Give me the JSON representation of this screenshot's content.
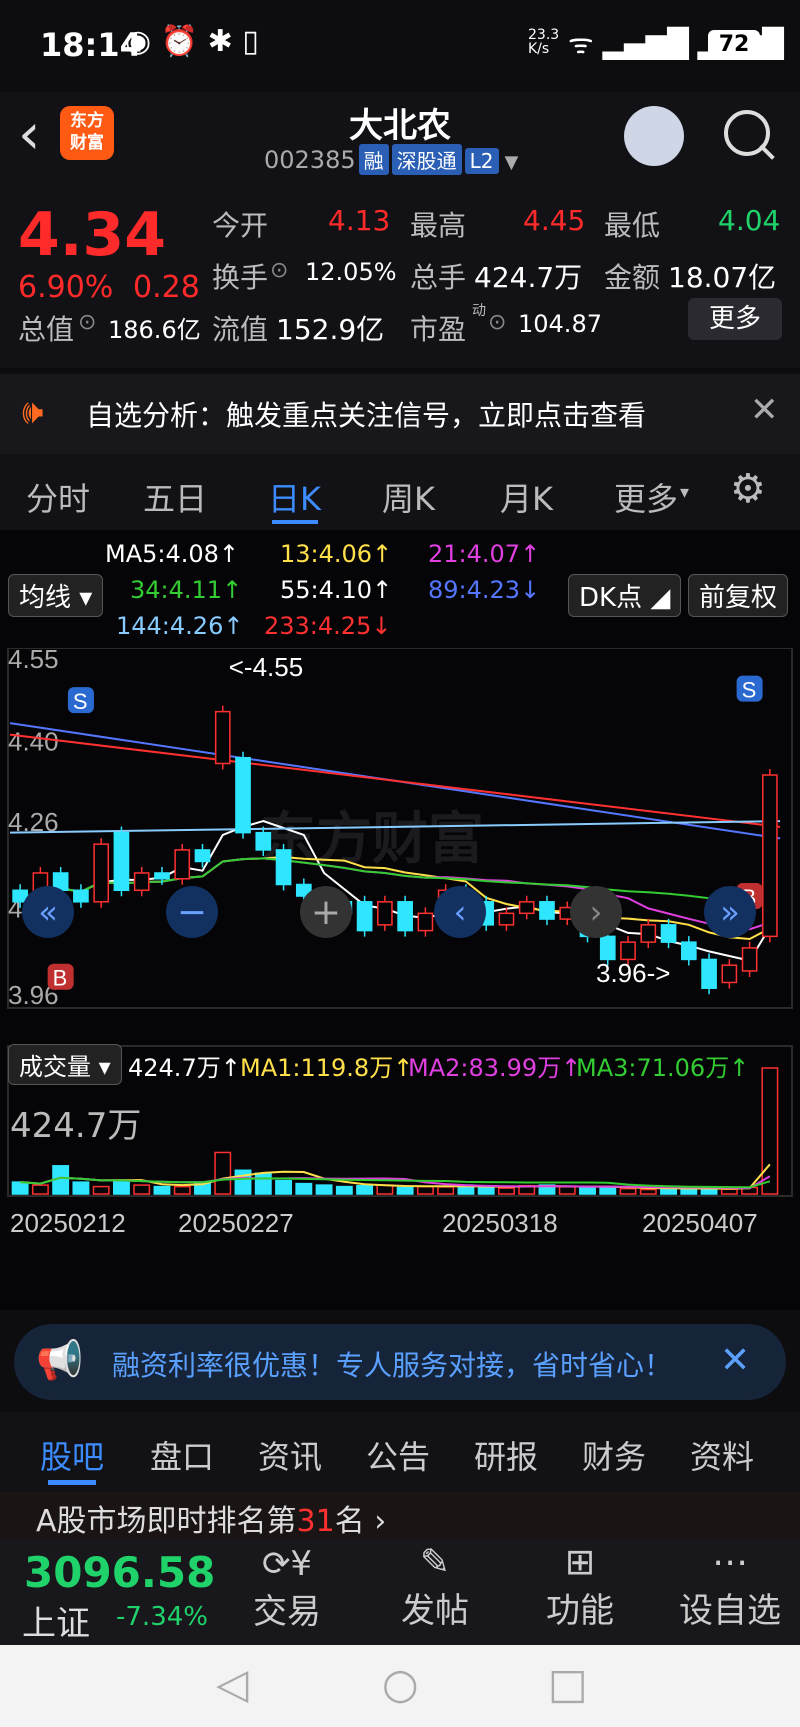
{
  "status": {
    "time": "18:14",
    "net_speed_top": "23.3",
    "net_speed_unit": "K/s",
    "wifi_tag": "6",
    "battery": "72"
  },
  "header": {
    "title": "大北农",
    "code": "002385",
    "tag1": "融",
    "tag2": "深股通",
    "tag3": "L2",
    "badge_line1": "东方",
    "badge_line2": "财富"
  },
  "quote": {
    "price": "4.34",
    "change_pct": "6.90%",
    "change": "0.28",
    "open_label": "今开",
    "open": "4.13",
    "high_label": "最高",
    "high": "4.45",
    "low_label": "最低",
    "low": "4.04",
    "turnover_label": "换手",
    "turnover": "12.05%",
    "volume_label": "总手",
    "volume": "424.7万",
    "amount_label": "金额",
    "amount": "18.07亿",
    "mcap_label": "总值",
    "mcap": "186.6亿",
    "float_label": "流值",
    "float": "152.9亿",
    "pe_label": "市盈",
    "pe_sup": "动",
    "pe": "104.87",
    "more_btn": "更多"
  },
  "banner1": {
    "text": "自选分析：触发重点关注信号，立即点击查看"
  },
  "tabs": [
    "分时",
    "五日",
    "日K",
    "周K",
    "月K",
    "更多"
  ],
  "active_tab": "日K",
  "ma_legend": {
    "ma5": "MA5:4.08↑",
    "ma13": "13:4.06↑",
    "ma21": "21:4.07↑",
    "ma34": "34:4.11↑",
    "ma55": "55:4.10↑",
    "ma89": "89:4.23↓",
    "ma144": "144:4.26↑",
    "ma233": "233:4.25↓",
    "left_btn": "均线",
    "dk_btn": "DK点",
    "fq_btn": "前复权"
  },
  "price_axis": [
    "4.55",
    "4.40",
    "4.26",
    "4.11",
    "3.96"
  ],
  "annotations": {
    "high_mark": "<-4.55",
    "low_mark": "3.96->"
  },
  "vol_legend": {
    "btn": "成交量",
    "v": "424.7万↑",
    "ma1": "MA1:119.8万↑",
    "ma2": "MA2:83.99万↑",
    "ma3": "MA3:71.06万↑",
    "top": "424.7万"
  },
  "dates": [
    "20250212",
    "20250227",
    "20250318",
    "20250407"
  ],
  "watermark": "东方财富",
  "chart_data": {
    "type": "candlestick",
    "ylim": [
      3.96,
      4.55
    ],
    "candles": [
      {
        "o": 4.14,
        "c": 4.12
      },
      {
        "o": 4.13,
        "c": 4.17
      },
      {
        "o": 4.17,
        "c": 4.14
      },
      {
        "o": 4.14,
        "c": 4.12
      },
      {
        "o": 4.12,
        "c": 4.22
      },
      {
        "o": 4.24,
        "c": 4.14
      },
      {
        "o": 4.14,
        "c": 4.17
      },
      {
        "o": 4.17,
        "c": 4.16
      },
      {
        "o": 4.16,
        "c": 4.21
      },
      {
        "o": 4.21,
        "c": 4.19
      },
      {
        "o": 4.36,
        "c": 4.45
      },
      {
        "o": 4.37,
        "c": 4.24
      },
      {
        "o": 4.24,
        "c": 4.21
      },
      {
        "o": 4.21,
        "c": 4.15
      },
      {
        "o": 4.15,
        "c": 4.13
      },
      {
        "o": 4.13,
        "c": 4.12
      },
      {
        "o": 4.12,
        "c": 4.1
      },
      {
        "o": 4.12,
        "c": 4.07
      },
      {
        "o": 4.08,
        "c": 4.12
      },
      {
        "o": 4.12,
        "c": 4.07
      },
      {
        "o": 4.07,
        "c": 4.1
      },
      {
        "o": 4.1,
        "c": 4.14
      },
      {
        "o": 4.14,
        "c": 4.12
      },
      {
        "o": 4.12,
        "c": 4.08
      },
      {
        "o": 4.08,
        "c": 4.1
      },
      {
        "o": 4.1,
        "c": 4.12
      },
      {
        "o": 4.12,
        "c": 4.09
      },
      {
        "o": 4.09,
        "c": 4.11
      },
      {
        "o": 4.11,
        "c": 4.06
      },
      {
        "o": 4.06,
        "c": 4.02
      },
      {
        "o": 4.02,
        "c": 4.05
      },
      {
        "o": 4.05,
        "c": 4.08
      },
      {
        "o": 4.08,
        "c": 4.05
      },
      {
        "o": 4.05,
        "c": 4.02
      },
      {
        "o": 4.02,
        "c": 3.97
      },
      {
        "o": 3.98,
        "c": 4.01
      },
      {
        "o": 4.0,
        "c": 4.04
      },
      {
        "o": 4.06,
        "c": 4.34
      }
    ],
    "volumes_wan": [
      40,
      30,
      95,
      40,
      25,
      45,
      30,
      25,
      25,
      40,
      140,
      80,
      70,
      45,
      35,
      30,
      25,
      28,
      30,
      22,
      25,
      24,
      30,
      25,
      20,
      28,
      30,
      25,
      22,
      20,
      18,
      15,
      22,
      18,
      20,
      16,
      22,
      424.7
    ]
  }
}
